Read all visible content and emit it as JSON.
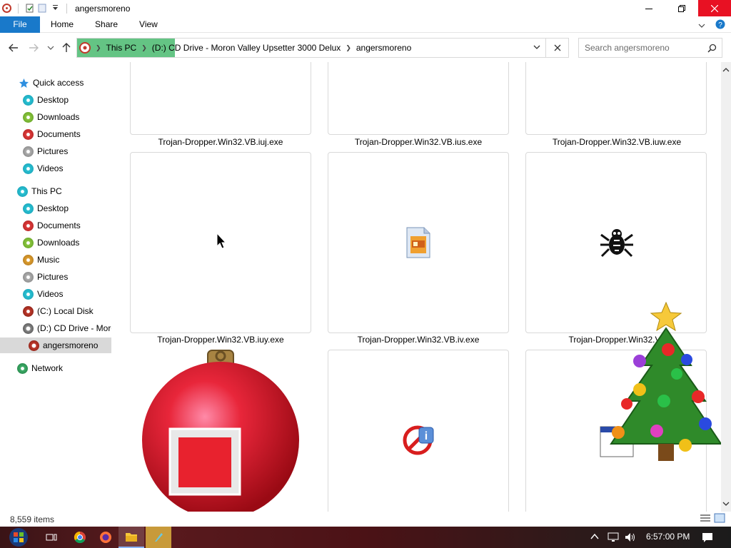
{
  "window": {
    "title": "angersmoreno"
  },
  "ribbon": {
    "tabs": [
      "File",
      "Home",
      "Share",
      "View"
    ]
  },
  "address": {
    "crumbs": [
      "This PC",
      "(D:) CD Drive - Moron Valley Upsetter 3000 Delux",
      "angersmoreno"
    ]
  },
  "search": {
    "placeholder": "Search angersmoreno"
  },
  "sidebar": {
    "quick_access": "Quick access",
    "quick_items": [
      "Desktop",
      "Downloads",
      "Documents",
      "Pictures",
      "Videos"
    ],
    "this_pc": "This PC",
    "pc_items": [
      "Desktop",
      "Documents",
      "Downloads",
      "Music",
      "Pictures",
      "Videos",
      "(C:) Local Disk",
      "(D:) CD Drive - Moron Valley Upsetter 3000 Delux",
      "angersmoreno"
    ],
    "network": "Network"
  },
  "files": {
    "row1": [
      "Trojan-Dropper.Win32.VB.iuj.exe",
      "Trojan-Dropper.Win32.VB.ius.exe",
      "Trojan-Dropper.Win32.VB.iuw.exe"
    ],
    "row2": [
      "Trojan-Dropper.Win32.VB.iuy.exe",
      "Trojan-Dropper.Win32.VB.iv.exe",
      "Trojan-Dropper.Win32.V"
    ]
  },
  "status": {
    "item_count": "8,559 items"
  },
  "taskbar": {
    "clock": "6:57:00 PM"
  },
  "colors": {
    "file_tab": "#1979ca",
    "close_button": "#e81123",
    "address_highlight": "#64c484",
    "selected_nav": "#d9d9d9"
  }
}
